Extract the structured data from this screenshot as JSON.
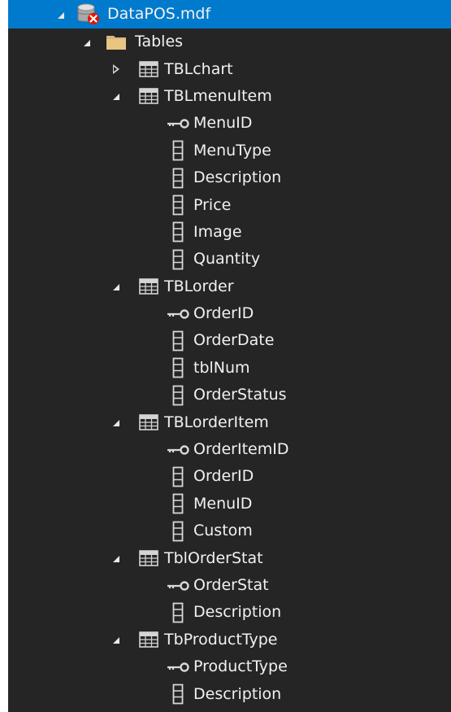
{
  "tree": {
    "rows": [
      {
        "label": "DataPOS.mdf",
        "icon": "database-error-icon",
        "expander": "expanded",
        "level": 0,
        "selected": true
      },
      {
        "label": "Tables",
        "icon": "folder-icon",
        "expander": "expanded",
        "level": 1
      },
      {
        "label": "TBLchart",
        "icon": "table-icon",
        "expander": "collapsed",
        "level": 2
      },
      {
        "label": "TBLmenuItem",
        "icon": "table-icon",
        "expander": "expanded",
        "level": 2
      },
      {
        "label": "MenuID",
        "icon": "key-icon",
        "expander": "none",
        "level": 3
      },
      {
        "label": "MenuType",
        "icon": "column-icon",
        "expander": "none",
        "level": 3
      },
      {
        "label": "Description",
        "icon": "column-icon",
        "expander": "none",
        "level": 3
      },
      {
        "label": "Price",
        "icon": "column-icon",
        "expander": "none",
        "level": 3
      },
      {
        "label": "Image",
        "icon": "column-icon",
        "expander": "none",
        "level": 3
      },
      {
        "label": "Quantity",
        "icon": "column-icon",
        "expander": "none",
        "level": 3
      },
      {
        "label": "TBLorder",
        "icon": "table-icon",
        "expander": "expanded",
        "level": 2
      },
      {
        "label": "OrderID",
        "icon": "key-icon",
        "expander": "none",
        "level": 3
      },
      {
        "label": "OrderDate",
        "icon": "column-icon",
        "expander": "none",
        "level": 3
      },
      {
        "label": "tblNum",
        "icon": "column-icon",
        "expander": "none",
        "level": 3
      },
      {
        "label": "OrderStatus",
        "icon": "column-icon",
        "expander": "none",
        "level": 3
      },
      {
        "label": "TBLorderItem",
        "icon": "table-icon",
        "expander": "expanded",
        "level": 2
      },
      {
        "label": "OrderItemID",
        "icon": "key-icon",
        "expander": "none",
        "level": 3
      },
      {
        "label": "OrderID",
        "icon": "column-icon",
        "expander": "none",
        "level": 3
      },
      {
        "label": "MenuID",
        "icon": "column-icon",
        "expander": "none",
        "level": 3
      },
      {
        "label": "Custom",
        "icon": "column-icon",
        "expander": "none",
        "level": 3
      },
      {
        "label": "TblOrderStat",
        "icon": "table-icon",
        "expander": "expanded",
        "level": 2
      },
      {
        "label": "OrderStat",
        "icon": "key-icon",
        "expander": "none",
        "level": 3
      },
      {
        "label": "Description",
        "icon": "column-icon",
        "expander": "none",
        "level": 3
      },
      {
        "label": "TbProductType",
        "icon": "table-icon",
        "expander": "expanded",
        "level": 2
      },
      {
        "label": "ProductType",
        "icon": "key-icon",
        "expander": "none",
        "level": 3
      },
      {
        "label": "Description",
        "icon": "column-icon",
        "expander": "none",
        "level": 3
      }
    ]
  },
  "colors": {
    "background": "#252526",
    "selection": "#007acc",
    "text": "#f1f1f1",
    "folder": "#dcb67a",
    "error": "#e51400"
  }
}
